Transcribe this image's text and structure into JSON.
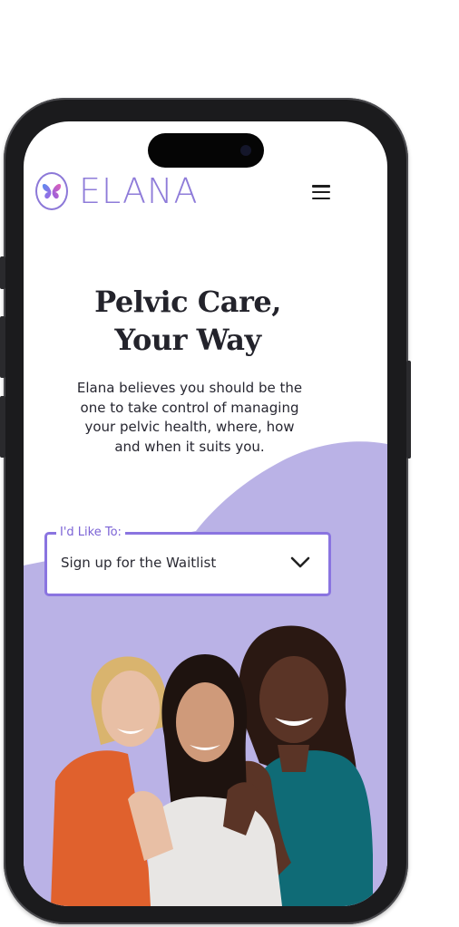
{
  "brand": {
    "name": "ELANA",
    "accent": "#8e7bd9",
    "lavender": "#bab2e6"
  },
  "header": {
    "menu_icon": "hamburger-menu-icon"
  },
  "hero": {
    "title_line1": "Pelvic Care,",
    "title_line2": "Your Way",
    "description": "Elana believes you should be the one to take control of managing your pelvic health, where, how and when it suits you."
  },
  "intent_select": {
    "label": "I'd Like To:",
    "value": "Sign up for the Waitlist",
    "icon": "chevron-down-icon"
  },
  "photo": {
    "subject": "three smiling women hugging"
  }
}
